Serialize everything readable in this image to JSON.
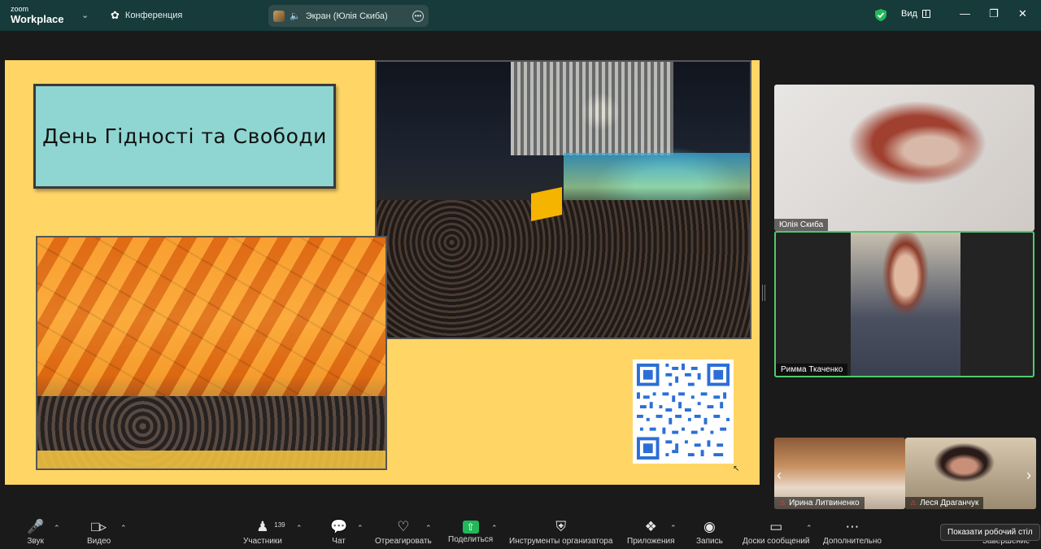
{
  "app": {
    "brand_small": "zoom",
    "brand_name": "Workplace",
    "meeting_label": "Конференция",
    "screen_share_label": "Экран (Юлія Скиба)",
    "view_label": "Вид"
  },
  "slide": {
    "title": "День Гідності та Свободи"
  },
  "participants": [
    {
      "name": "Юлія Скиба"
    },
    {
      "name": "Римма Ткаченко"
    },
    {
      "name": "Ирина Литвиненко"
    },
    {
      "name": "Леся Драганчук"
    }
  ],
  "toolbar": {
    "audio": "Звук",
    "video": "Видео",
    "participants": "Участники",
    "participants_count": "139",
    "chat": "Чат",
    "react": "Отреагировать",
    "share": "Поделиться",
    "host_tools": "Инструменты организатора",
    "apps": "Приложения",
    "record": "Запись",
    "boards": "Доски сообщений",
    "more": "Дополнительно",
    "end": "Завершение"
  },
  "tooltip": "Показати робочий стіл",
  "colors": {
    "titlebar": "#173a3a",
    "slide_bg": "#ffd666",
    "title_box": "#8fd6d2",
    "active_speaker_border": "#4ecb6a",
    "share_green": "#22b85a"
  }
}
